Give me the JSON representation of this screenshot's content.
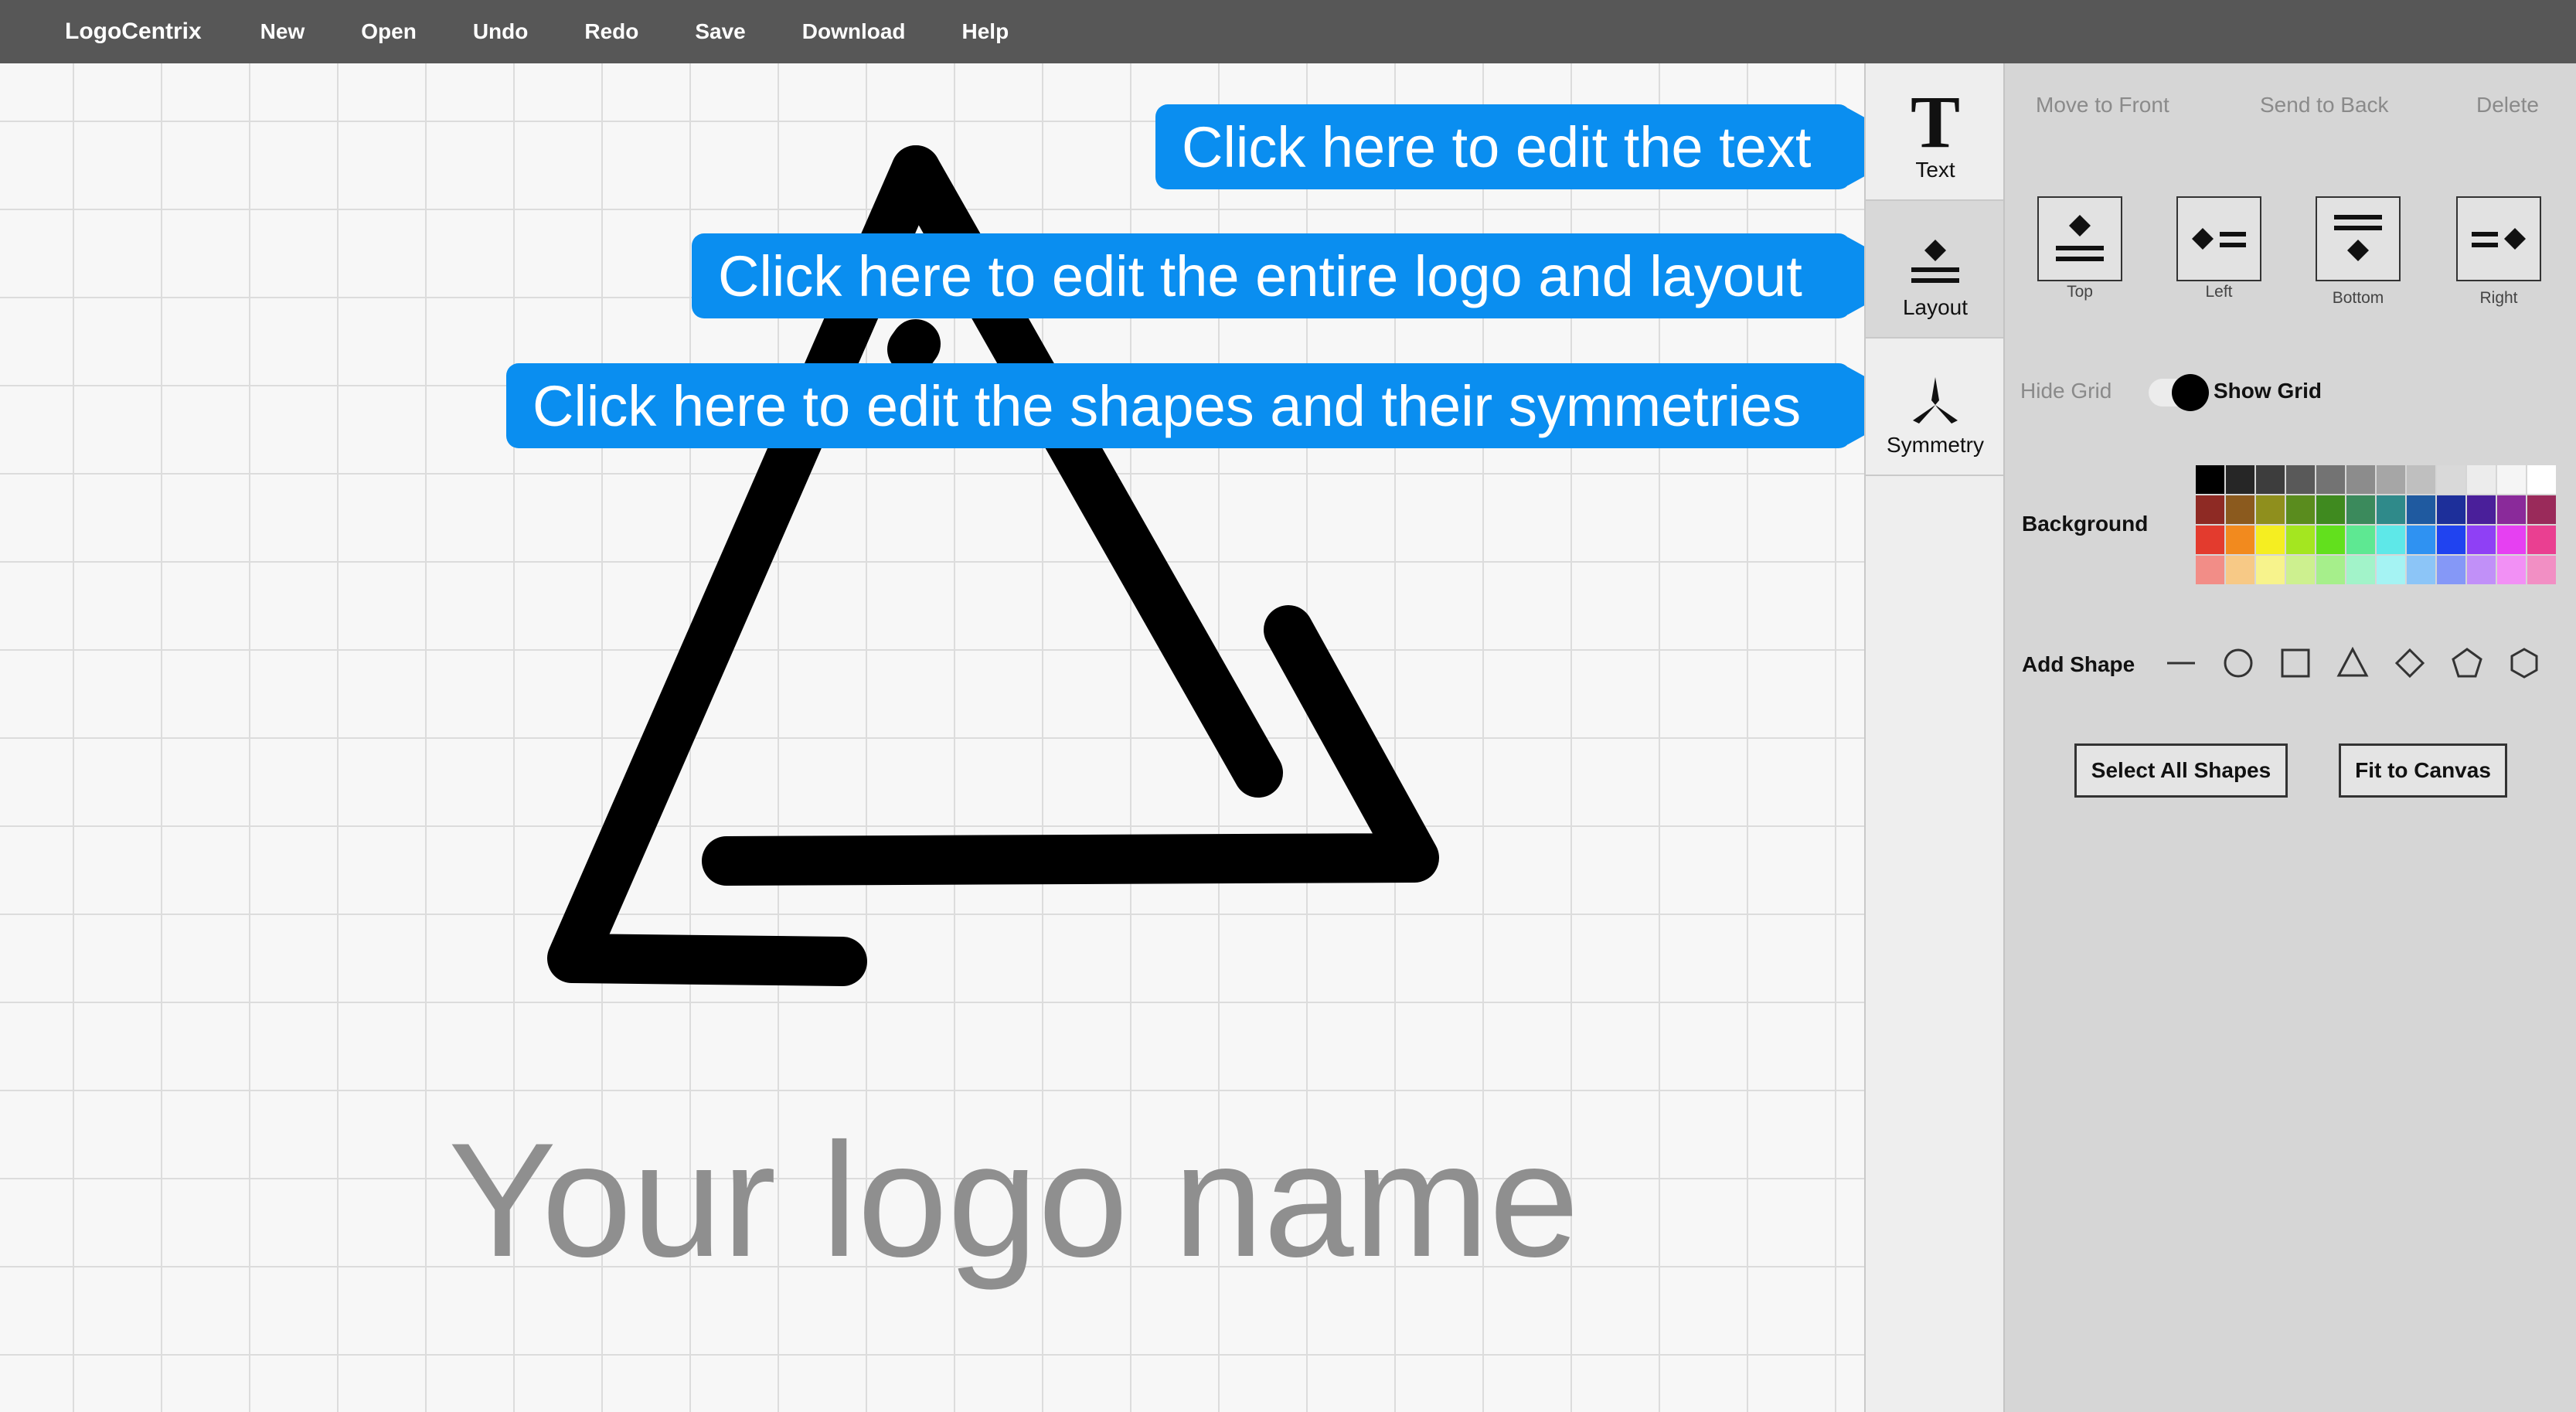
{
  "app": {
    "name": "LogoCentrix"
  },
  "menu": [
    "New",
    "Open",
    "Undo",
    "Redo",
    "Save",
    "Download",
    "Help"
  ],
  "canvas": {
    "logo_name": "Your logo name",
    "logo_name_color": "#8f8f8f"
  },
  "callouts": {
    "text": "Click here to edit the text",
    "layout": "Click here to edit the entire logo and layout",
    "symmetry": "Click here to edit the shapes and their symmetries",
    "color": "#0a8ef0"
  },
  "tools": {
    "text": "Text",
    "layout": "Layout",
    "symmetry": "Symmetry"
  },
  "panel": {
    "order": {
      "front": "Move to Front",
      "back": "Send to Back",
      "delete": "Delete"
    },
    "align": {
      "top": "Top",
      "left": "Left",
      "bottom": "Bottom",
      "right": "Right"
    },
    "grid": {
      "hide": "Hide Grid",
      "show": "Show Grid",
      "state": "show"
    },
    "background_label": "Background",
    "palette": [
      "#000000",
      "#262626",
      "#3d3d3d",
      "#595959",
      "#737373",
      "#8c8c8c",
      "#a6a6a6",
      "#bfbfbf",
      "#d9d9d9",
      "#ececec",
      "#f5f5f5",
      "#ffffff",
      "#8e2a24",
      "#8b5a1e",
      "#8f8f1d",
      "#5a8c1e",
      "#3f8a1f",
      "#3b8a5c",
      "#2f8a8a",
      "#1f5aa0",
      "#1d2f9a",
      "#4a1f9a",
      "#8a2a9a",
      "#9a2a5a",
      "#e33b2e",
      "#f28a1e",
      "#f5ee21",
      "#a4e620",
      "#62e01d",
      "#5ee892",
      "#5ee8e8",
      "#2f92f2",
      "#2043f0",
      "#8f40f5",
      "#e640f2",
      "#ea3f91",
      "#f28d87",
      "#f7c986",
      "#f7f38c",
      "#cdf08f",
      "#a6ef8b",
      "#a2f3c9",
      "#a5f3f3",
      "#8cc5f7",
      "#8598f7",
      "#c190f8",
      "#f290f5",
      "#f28fc4"
    ],
    "add_shape_label": "Add Shape",
    "shapes": [
      "line-icon",
      "circle-icon",
      "square-icon",
      "triangle-icon",
      "diamond-icon",
      "pentagon-icon",
      "hexagon-icon"
    ],
    "buttons": {
      "select_all": "Select All Shapes",
      "fit": "Fit to Canvas"
    }
  }
}
